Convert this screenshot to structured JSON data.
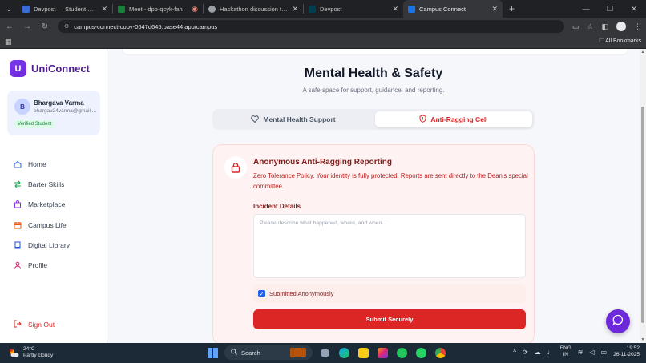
{
  "browser": {
    "tabs": [
      {
        "label": "Devpost — Student Guide for H",
        "active": false,
        "color": "#3b6bd6"
      },
      {
        "label": "Meet - dpo-qcyk-fah",
        "active": false,
        "color": "#188038"
      },
      {
        "label": "Hackathon discussion topics",
        "active": false,
        "color": "#9aa0a6"
      },
      {
        "label": "Devpost",
        "active": false,
        "color": "#003e54"
      },
      {
        "label": "Campus Connect",
        "active": true,
        "color": "#1a73e8"
      }
    ],
    "url": "campus-connect-copy-0647d645.base44.app/campus",
    "bookmarks_label": "All Bookmarks"
  },
  "sidebar": {
    "logo_letter": "U",
    "app_name": "UniConnect",
    "user": {
      "initial": "B",
      "name": "Bhargava Varma",
      "email": "bhargav24varma@gmail....",
      "badge": "Verified Student"
    },
    "items": [
      {
        "label": "Home",
        "icon": "home-icon"
      },
      {
        "label": "Barter Skills",
        "icon": "swap-icon"
      },
      {
        "label": "Marketplace",
        "icon": "shopping-bag-icon"
      },
      {
        "label": "Campus Life",
        "icon": "calendar-icon"
      },
      {
        "label": "Digital Library",
        "icon": "book-icon"
      },
      {
        "label": "Profile",
        "icon": "user-icon"
      }
    ],
    "signout_label": "Sign Out"
  },
  "main": {
    "title": "Mental Health & Safety",
    "subtitle": "A safe space for support, guidance, and reporting.",
    "tabs": [
      {
        "label": "Mental Health Support",
        "icon": "heart-icon",
        "active": false
      },
      {
        "label": "Anti-Ragging Cell",
        "icon": "shield-icon",
        "active": true
      }
    ],
    "report": {
      "title": "Anonymous Anti-Ragging Reporting",
      "description": "Zero Tolerance Policy. Your identity is fully protected. Reports are sent directly to the Dean's special committee.",
      "field_label": "Incident Details",
      "placeholder": "Please describe what happened, where, and when...",
      "anonymous_label": "Submitted Anonymously",
      "anonymous_checked": true,
      "submit_label": "Submit Securely"
    }
  },
  "taskbar": {
    "temperature": "24°C",
    "weather": "Partly cloudy",
    "search_label": "Search",
    "language_line1": "ENG",
    "language_line2": "IN",
    "time": "19:52",
    "date": "26-11-2025"
  },
  "colors": {
    "accent": "#6d28d9",
    "danger": "#dc2626",
    "danger_bg": "#fef3f2"
  }
}
